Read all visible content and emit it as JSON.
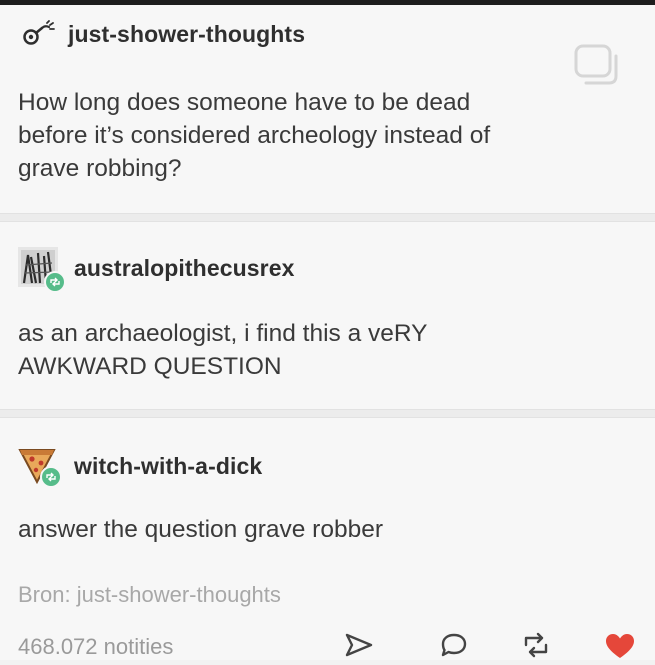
{
  "posts": [
    {
      "username": "just-shower-thoughts",
      "lines": [
        "How long does someone have to be dead",
        "before it’s considered archeology instead of",
        "grave robbing?"
      ]
    },
    {
      "username": "australopithecusrex",
      "lines": [
        "as an archaeologist, i find this a veRY",
        "AWKWARD QUESTION"
      ]
    },
    {
      "username": "witch-with-a-dick",
      "lines": [
        "answer the question grave robber"
      ]
    }
  ],
  "source_label": "Bron: just-shower-thoughts",
  "notes_label": "468.072 notities",
  "icons": {
    "first_avatar": "shower-head-icon",
    "copy": "copy-icon",
    "share": "send-icon",
    "reply": "reply-bubble-icon",
    "reblog": "reblog-icon",
    "like": "heart-icon"
  },
  "colors": {
    "heart": "#e5473a",
    "reblog_badge": "#56bc8a",
    "text": "#3a3a3a",
    "muted": "#a8a8a8"
  }
}
